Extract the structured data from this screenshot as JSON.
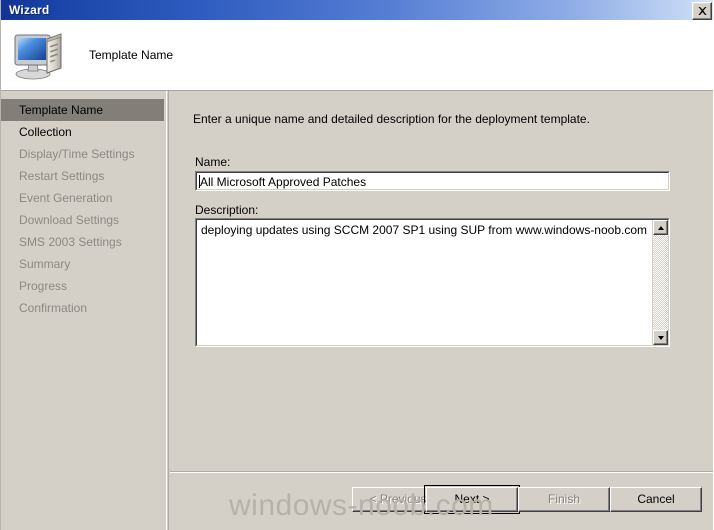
{
  "window": {
    "title": "Wizard",
    "close_label": "X"
  },
  "header": {
    "title": "Template Name",
    "icon": "computer-icon"
  },
  "sidebar": {
    "items": [
      {
        "label": "Template Name",
        "state": "selected"
      },
      {
        "label": "Collection",
        "state": "enabled"
      },
      {
        "label": "Display/Time Settings",
        "state": "disabled"
      },
      {
        "label": "Restart Settings",
        "state": "disabled"
      },
      {
        "label": "Event Generation",
        "state": "disabled"
      },
      {
        "label": "Download Settings",
        "state": "disabled"
      },
      {
        "label": "SMS 2003 Settings",
        "state": "disabled"
      },
      {
        "label": "Summary",
        "state": "disabled"
      },
      {
        "label": "Progress",
        "state": "disabled"
      },
      {
        "label": "Confirmation",
        "state": "disabled"
      }
    ]
  },
  "main": {
    "instruction": "Enter a unique name and detailed description for the deployment template.",
    "name": {
      "label": "Name:",
      "value": "All Microsoft Approved Patches"
    },
    "description": {
      "label": "Description:",
      "value": "deploying updates using SCCM 2007 SP1 using SUP from www.windows-noob.com"
    },
    "scrollbar": {
      "up_icon": "scroll-up-arrow-icon",
      "down_icon": "scroll-down-arrow-icon"
    }
  },
  "footer": {
    "buttons": [
      {
        "label": "< Previous",
        "state": "disabled"
      },
      {
        "label": "Next >",
        "state": "default"
      },
      {
        "label": "Finish",
        "state": "disabled"
      },
      {
        "label": "Cancel",
        "state": "enabled"
      }
    ]
  },
  "watermark": {
    "text": "windows-noob.com"
  },
  "colors": {
    "dialog_face": "#d4d0c8",
    "title_gradient_start": "#133395",
    "title_gradient_end": "#dfe9f8",
    "selected_step": "#817f78",
    "disabled_text": "#8a8a82",
    "watermark": "#b6b2aa"
  }
}
